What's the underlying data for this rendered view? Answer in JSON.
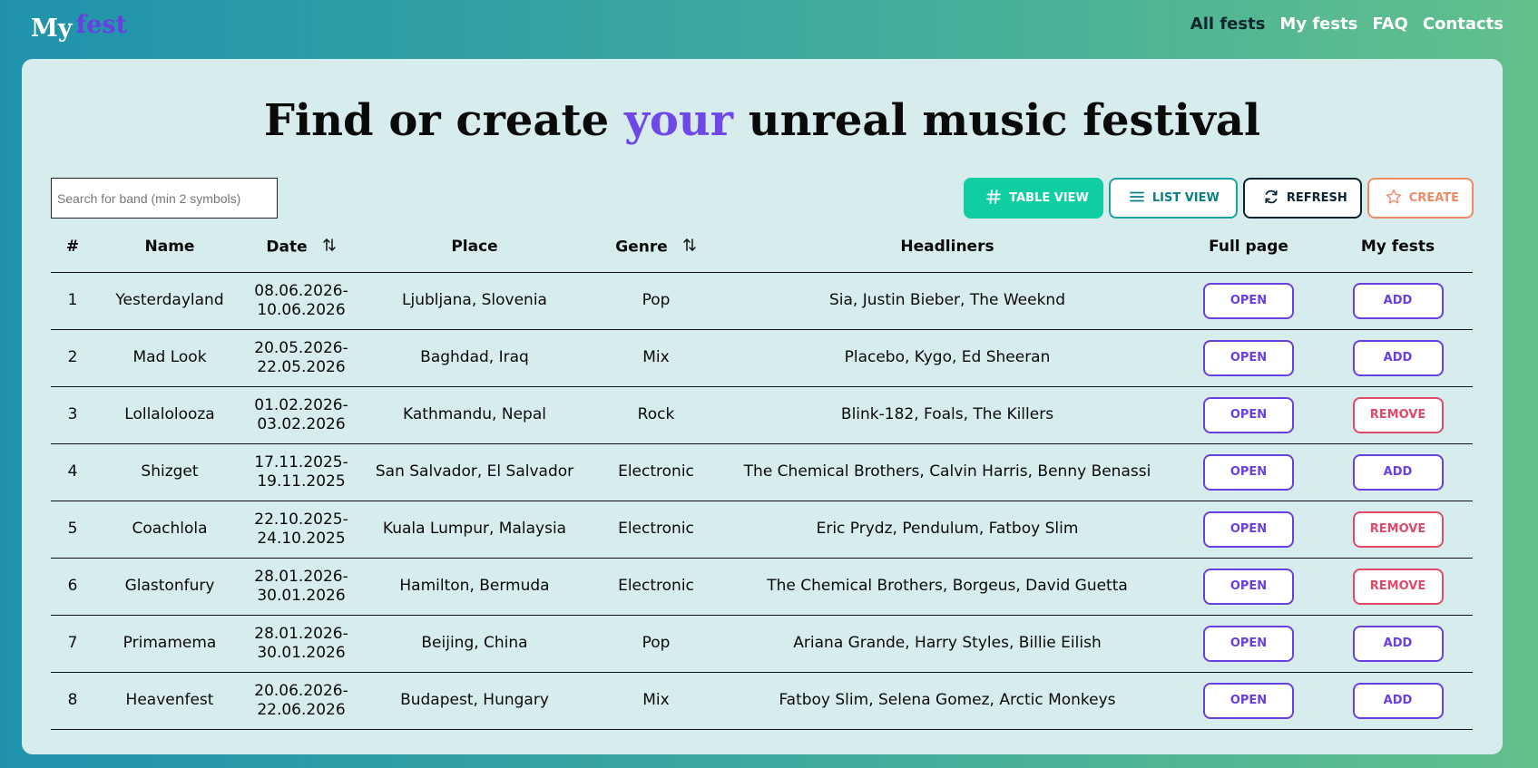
{
  "logo": {
    "my": "My",
    "fest": "fest"
  },
  "nav": [
    {
      "label": "All fests",
      "active": true
    },
    {
      "label": "My fests",
      "active": false
    },
    {
      "label": "FAQ",
      "active": false
    },
    {
      "label": "Contacts",
      "active": false
    }
  ],
  "headline": {
    "before": "Find or create",
    "accent": "your",
    "after": "unreal music festival"
  },
  "search": {
    "placeholder": "Search for band (min 2 symbols)",
    "value": ""
  },
  "toolbar": {
    "table_view": "TABLE VIEW",
    "list_view": "LIST VIEW",
    "refresh": "REFRESH",
    "create": "CREATE"
  },
  "table": {
    "headers": [
      "#",
      "Name",
      "Date",
      "Place",
      "Genre",
      "Headliners",
      "Full page",
      "My fests"
    ],
    "rows": [
      {
        "num": "1",
        "name": "Yesterdayland",
        "date_start": "08.06.2026-",
        "date_end": "10.06.2026",
        "place": "Ljubljana, Slovenia",
        "genre": "Pop",
        "headliners": "Sia, Justin Bieber, The Weeknd",
        "full_page": "OPEN",
        "my_fests": "ADD"
      },
      {
        "num": "2",
        "name": "Mad Look",
        "date_start": "20.05.2026-",
        "date_end": "22.05.2026",
        "place": "Baghdad, Iraq",
        "genre": "Mix",
        "headliners": "Placebo, Kygo, Ed Sheeran",
        "full_page": "OPEN",
        "my_fests": "ADD"
      },
      {
        "num": "3",
        "name": "Lollalolooza",
        "date_start": "01.02.2026-",
        "date_end": "03.02.2026",
        "place": "Kathmandu, Nepal",
        "genre": "Rock",
        "headliners": "Blink-182, Foals, The Killers",
        "full_page": "OPEN",
        "my_fests": "REMOVE"
      },
      {
        "num": "4",
        "name": "Shizget",
        "date_start": "17.11.2025-",
        "date_end": "19.11.2025",
        "place": "San Salvador, El Salvador",
        "genre": "Electronic",
        "headliners": "The Chemical Brothers, Calvin Harris, Benny Benassi",
        "full_page": "OPEN",
        "my_fests": "ADD"
      },
      {
        "num": "5",
        "name": "Coachlola",
        "date_start": "22.10.2025-",
        "date_end": "24.10.2025",
        "place": "Kuala Lumpur, Malaysia",
        "genre": "Electronic",
        "headliners": "Eric Prydz, Pendulum, Fatboy Slim",
        "full_page": "OPEN",
        "my_fests": "REMOVE"
      },
      {
        "num": "6",
        "name": "Glastonfury",
        "date_start": "28.01.2026-",
        "date_end": "30.01.2026",
        "place": "Hamilton, Bermuda",
        "genre": "Electronic",
        "headliners": "The Chemical Brothers, Borgeus, David Guetta",
        "full_page": "OPEN",
        "my_fests": "REMOVE"
      },
      {
        "num": "7",
        "name": "Primamema",
        "date_start": "28.01.2026-",
        "date_end": "30.01.2026",
        "place": "Beijing, China",
        "genre": "Pop",
        "headliners": "Ariana Grande, Harry Styles, Billie Eilish",
        "full_page": "OPEN",
        "my_fests": "ADD"
      },
      {
        "num": "8",
        "name": "Heavenfest",
        "date_start": "20.06.2026-",
        "date_end": "22.06.2026",
        "place": "Budapest, Hungary",
        "genre": "Mix",
        "headliners": "Fatboy Slim, Selena Gomez, Arctic Monkeys",
        "full_page": "OPEN",
        "my_fests": "ADD"
      }
    ]
  },
  "colors": {
    "brand_purple": "#6a3fe0",
    "accent_green": "#0fcea2",
    "remove_red": "#e04a6a",
    "create_orange": "#ee8a64",
    "panel_bg": "#d7ecec"
  }
}
